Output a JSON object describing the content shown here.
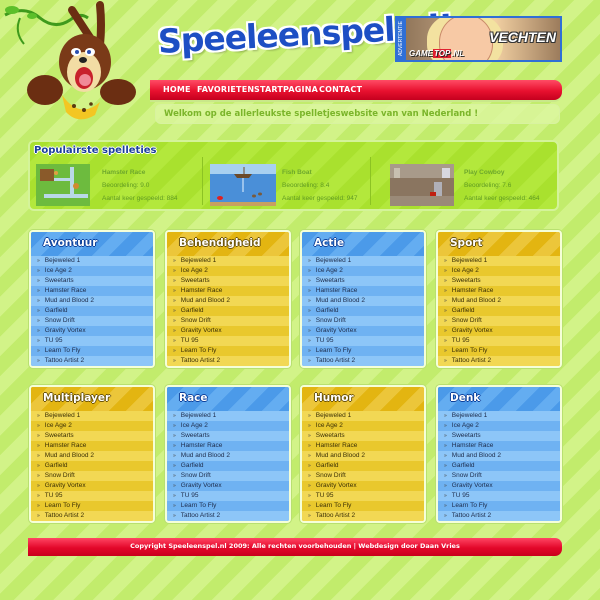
{
  "site": {
    "logo_text": "Speeleenspel.nl!"
  },
  "ad": {
    "side_label": "ADVERTENTIE",
    "title": "VECHTEN",
    "brand_prefix": "GAME",
    "brand_highlight": "TOP",
    "brand_suffix": ".NL"
  },
  "nav": {
    "items": [
      {
        "label": "HOME"
      },
      {
        "label": "FAVORIETEN"
      },
      {
        "label": "STARTPAGINA"
      },
      {
        "label": "CONTACT"
      }
    ]
  },
  "welcome": {
    "text": "Welkom op de allerleukste spelletjeswebsite van van Nederland !"
  },
  "popular": {
    "title": "Populairste spelleties",
    "games": [
      {
        "name": "Hamster Race",
        "rating": "Beoordeling: 9.0",
        "plays": "Aantal keer gespeeld: 884"
      },
      {
        "name": "Fish Boat",
        "rating": "Beoordeling: 8.4",
        "plays": "Aantal keer gespeeld: 947"
      },
      {
        "name": "Play Cowboy",
        "rating": "Beoordeling: 7.6",
        "plays": "Aantal keer gespeeld: 464"
      }
    ]
  },
  "categories": [
    {
      "title": "Avontuur",
      "color": "blue"
    },
    {
      "title": "Behendigheid",
      "color": "yellow"
    },
    {
      "title": "Actie",
      "color": "blue"
    },
    {
      "title": "Sport",
      "color": "yellow"
    },
    {
      "title": "Multiplayer",
      "color": "yellow"
    },
    {
      "title": "Race",
      "color": "blue"
    },
    {
      "title": "Humor",
      "color": "yellow"
    },
    {
      "title": "Denk",
      "color": "blue"
    }
  ],
  "category_games": [
    "Bejeweled 1",
    "Ice Age 2",
    "Sweetarts",
    "Hamster Race",
    "Mud and Blood 2",
    "Garfield",
    "Snow Drift",
    "Gravity Vortex",
    "TU 95",
    "Learn To Fly",
    "Tattoo Artist 2"
  ],
  "bullet": "»",
  "footer": {
    "text": "Copyright Speeleenspel.nl 2009: Alle rechten voorbehouden  |  Webdesign door Daan Vries"
  },
  "colors": {
    "background": "#c9f07a",
    "nav_red": "#e8102f",
    "logo_blue": "#1d4fc4",
    "box_blue": "#5aa6ee",
    "box_yellow": "#e7bd17",
    "popular_green": "#a9e12e"
  }
}
